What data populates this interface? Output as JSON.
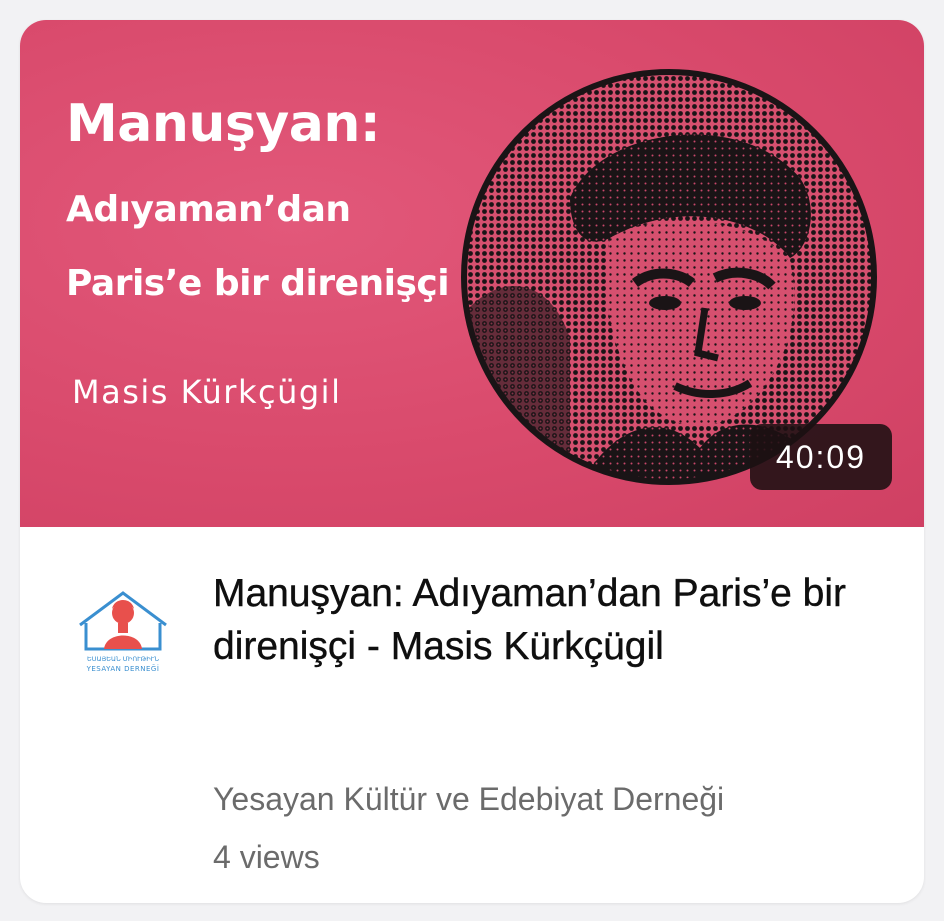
{
  "thumbnail": {
    "title_line": "Manuşyan:",
    "subtitle_line1": "Adıyaman’dan",
    "subtitle_line2": "Paris’e bir direnişçi",
    "author": "Masis Kürkçügil",
    "duration": "40:09",
    "background_color": "#d94a6c"
  },
  "video": {
    "title": "Manuşyan: Adıyaman’dan Paris’e bir direnişçi - Masis Kürkçügil",
    "channel": "Yesayan Kültür ve Edebiyat Derneği",
    "views": "4 views"
  },
  "channel_logo": {
    "icon": "yesayan-logo-icon",
    "armenian_text": "ԵՍԱՅԵԱՆ ՄԻՈՒԹԻՒՆ",
    "latin_text": "YESAYAN DERNEĞİ",
    "accent_color": "#e8504c",
    "line_color": "#3a8fd0"
  }
}
